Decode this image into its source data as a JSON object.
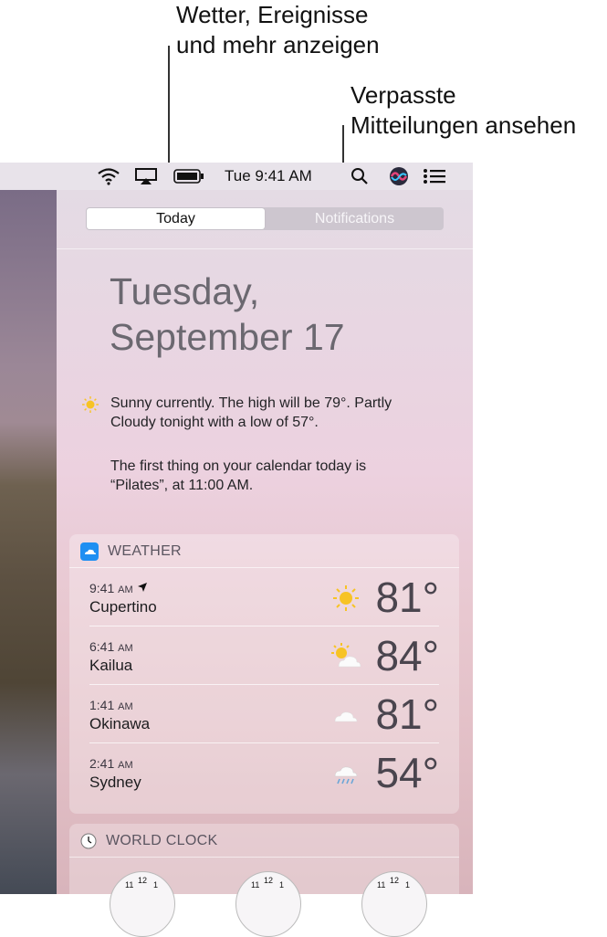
{
  "callouts": {
    "today": "Wetter, Ereignisse\nund mehr anzeigen",
    "notifications": "Verpasste\nMitteilungen ansehen"
  },
  "menubar": {
    "clock": "Tue 9:41 AM",
    "icons": [
      "wifi-icon",
      "airplay-icon",
      "battery-icon",
      "spotlight-search-icon",
      "siri-icon",
      "notification-center-icon"
    ]
  },
  "tabs": {
    "today": "Today",
    "notifications": "Notifications"
  },
  "today": {
    "date_line1": "Tuesday,",
    "date_line2": "September 17",
    "summary": "Sunny currently. The high will be 79°. Partly Cloudy tonight with a low of 57°.",
    "calendar": "The first thing on your calendar today is “Pilates”, at 11:00 AM."
  },
  "weather": {
    "title": "WEATHER",
    "rows": [
      {
        "time": "9:41",
        "ampm": "AM",
        "city": "Cupertino",
        "temp": "81°",
        "icon": "sun-icon"
      },
      {
        "time": "6:41",
        "ampm": "AM",
        "city": "Kailua",
        "temp": "84°",
        "icon": "partly-cloudy-icon"
      },
      {
        "time": "1:41",
        "ampm": "AM",
        "city": "Okinawa",
        "temp": "81°",
        "icon": "cloud-icon"
      },
      {
        "time": "2:41",
        "ampm": "AM",
        "city": "Sydney",
        "temp": "54°",
        "icon": "rain-icon"
      }
    ]
  },
  "world_clock": {
    "title": "WORLD CLOCK",
    "numerals": [
      "11",
      "12",
      "1"
    ]
  },
  "colors": {
    "accent_sun": "#f7c325",
    "weather_icon_blue": "#1f8ff2"
  }
}
